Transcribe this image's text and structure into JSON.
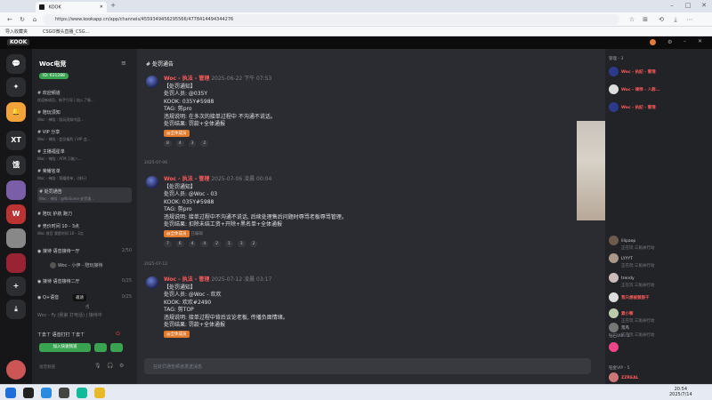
{
  "browser": {
    "tab_title": "KOOK",
    "url": "https://www.kookapp.cn/app/channels/4559349456295566/4778414494344276",
    "bookmarks": [
      "导入收藏夹",
      "CSGO微头直播_CSG..."
    ]
  },
  "server": {
    "name": "Woc电竞",
    "id_badge": "ID: 631288"
  },
  "channels": [
    {
      "name": "欢迎频道",
      "sub": "欢迎新成员，新手引导 | 加入了服..."
    },
    {
      "name": "陪玩须知",
      "sub": "Woc - 神陪 : 陪玩须知内容..."
    },
    {
      "name": "VIP 分享",
      "sub": "Woc - 神陪 : 会员福利 | VIP 会..."
    },
    {
      "name": "主播福星单",
      "sub": "Woc - 神陪 : ATM 万能八..."
    },
    {
      "name": "荣耀名单",
      "sub": "Woc - 神陪 : 荣耀榜单，(排行)"
    },
    {
      "name": "处罚通告",
      "sub": "Woc - 神陪 : @NoSome 处罚通..."
    },
    {
      "name": "陪玩 护航 跑刀",
      "sub": ""
    },
    {
      "name": "竞价时间 10 - 3点",
      "sub": "Woc 收官 我是时间 10 - 3点"
    }
  ],
  "voice_channels": [
    {
      "name": "接待 语音接待一厅",
      "count": "2/50"
    },
    {
      "name": "接待 语音接待二厅",
      "count": "0/25"
    },
    {
      "name": "Q+语音",
      "count": "0/25"
    }
  ],
  "voice_user": "Woc - 小伊 - 陪玩接待",
  "tooltip": "邀请",
  "bottom_status": "Woc - Fy (我第 打电话) | 接待中",
  "buttons": {
    "quickjoin": "加入快速频道",
    "chat": "语音频道"
  },
  "user_footer": "ㄒ去ㄒ 语音打打 ㄒ去ㄒ",
  "current_channel": "处罚通告",
  "messages": [
    {
      "author": "Woc - 执法 - 管理",
      "time": "2025-06-22 下午 07:53",
      "lines": [
        "【处罚通知】",
        "处罚人员: @035Y",
        "KOOK: 035Y#5988",
        "TAG: 剪pro",
        "违规说明: 在多次的接单过程中 不沟通不说话。",
        "处罚结果: 罚款+全体通报"
      ],
      "tag": "@全体成员",
      "reactions": [
        "8",
        "4",
        "3",
        "2"
      ]
    },
    {
      "date_divider": "2025-07-06",
      "author": "Woc - 执法 - 管理",
      "time": "2025-07-06 凌晨 00:04",
      "lines": [
        "【处罚通知】",
        "处罚人员: @Woc - 03",
        "KOOK: 035Y#5988",
        "TAG: 剪pro",
        "违规说明: 接单过程中不沟通不说话, 后续处理售后问题时辱骂老板辱骂管理。",
        "处罚结果: 扣除未结工资+开除+黑名单+全体通报"
      ],
      "tag": "@全体成员",
      "tag2": "已编辑",
      "reactions": [
        "7",
        "6",
        "4",
        "4",
        "2",
        "1",
        "3",
        "2"
      ]
    },
    {
      "date_divider": "2025-07-12",
      "author": "Woc - 执法 - 管理",
      "time": "2025-07-12 凌晨 03:17",
      "lines": [
        "【处罚通知】",
        "处罚人员: @Woc - 欢欢",
        "KOOK: 欢欢#2490",
        "TAG: 剪TOP",
        "违规说明: 接单过程中背后议论老板, 传播负面情绪。",
        "处罚结果: 罚款+全体通报"
      ],
      "tag": "@全体成员"
    }
  ],
  "input_placeholder": "在处罚通告频道发送消息",
  "members": {
    "section_admin": "管理 - 3",
    "admins": [
      "Woc - 执纪 - 管理",
      "Woc - 律师 - 人群...",
      "Woc - 执纪 - 管理"
    ],
    "online": [
      {
        "name": "lilipaop",
        "status": "正在玩 三角洲行动"
      },
      {
        "name": "LYYYT",
        "status": "正在玩 三角洲行动"
      },
      {
        "name": "trendy",
        "status": "正在玩 三角洲行动"
      },
      {
        "name": "我只想被狠狠干",
        "status": ""
      },
      {
        "name": "素小黎",
        "status": "正在玩 三角洲行动"
      },
      {
        "name": "荒鸟",
        "status": "正在玩 三角洲行动"
      }
    ],
    "section_vip": "钻石VIP - 1",
    "section_gold": "铂金VIP - 5",
    "vip_member": "ZZREAL"
  },
  "clock": {
    "time": "20:54",
    "date": "2025/7/14"
  }
}
